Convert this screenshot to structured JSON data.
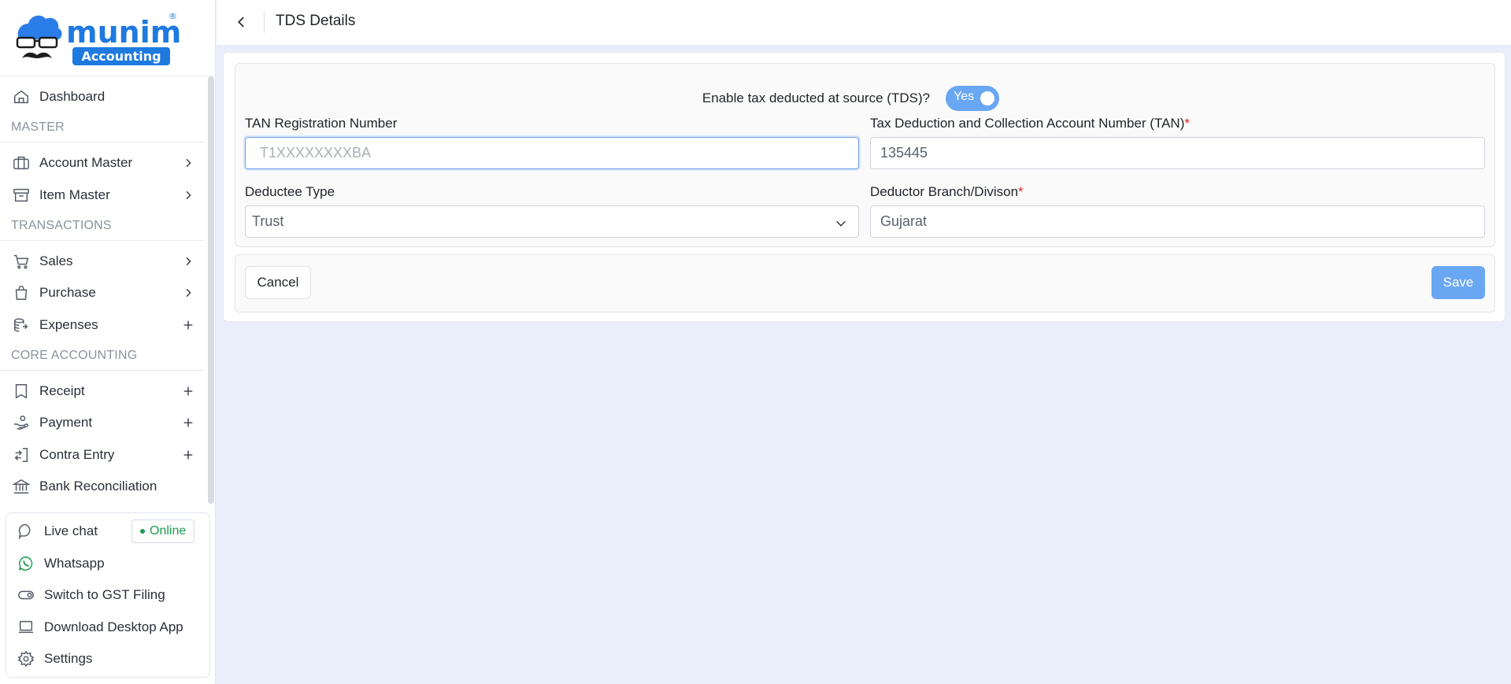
{
  "brand": {
    "name": "munim",
    "tagline": "Accounting",
    "registered": "®",
    "primary_color": "#1f7ae0"
  },
  "header": {
    "title": "TDS Details"
  },
  "sidebar": {
    "dashboard": "Dashboard",
    "section_master": "MASTER",
    "account_master": "Account Master",
    "item_master": "Item Master",
    "section_transactions": "TRANSACTIONS",
    "sales": "Sales",
    "purchase": "Purchase",
    "expenses": "Expenses",
    "section_core": "CORE ACCOUNTING",
    "receipt": "Receipt",
    "payment": "Payment",
    "contra_entry": "Contra Entry",
    "bank_reconciliation": "Bank Reconciliation"
  },
  "bottom": {
    "live_chat": "Live chat",
    "online": "Online",
    "whatsapp": "Whatsapp",
    "switch_gst": "Switch to GST Filing",
    "download_app": "Download Desktop App",
    "settings": "Settings"
  },
  "form": {
    "tds_question": "Enable tax deducted at source (TDS)?",
    "tds_toggle": "Yes",
    "tan_reg_label": "TAN Registration Number",
    "tan_reg_placeholder": "T1XXXXXXXXBA",
    "tan_label": "Tax Deduction and Collection Account Number (TAN)",
    "tan_value": "135445",
    "deductee_label": "Deductee Type",
    "deductee_value": "Trust",
    "branch_label": "Deductor Branch/Divison",
    "branch_value": "Gujarat",
    "required_mark": "*"
  },
  "actions": {
    "cancel": "Cancel",
    "save": "Save"
  },
  "colors": {
    "accent": "#6aa7f2",
    "online": "#1a9c4f",
    "required": "#e02424",
    "background": "#eaeefb"
  }
}
